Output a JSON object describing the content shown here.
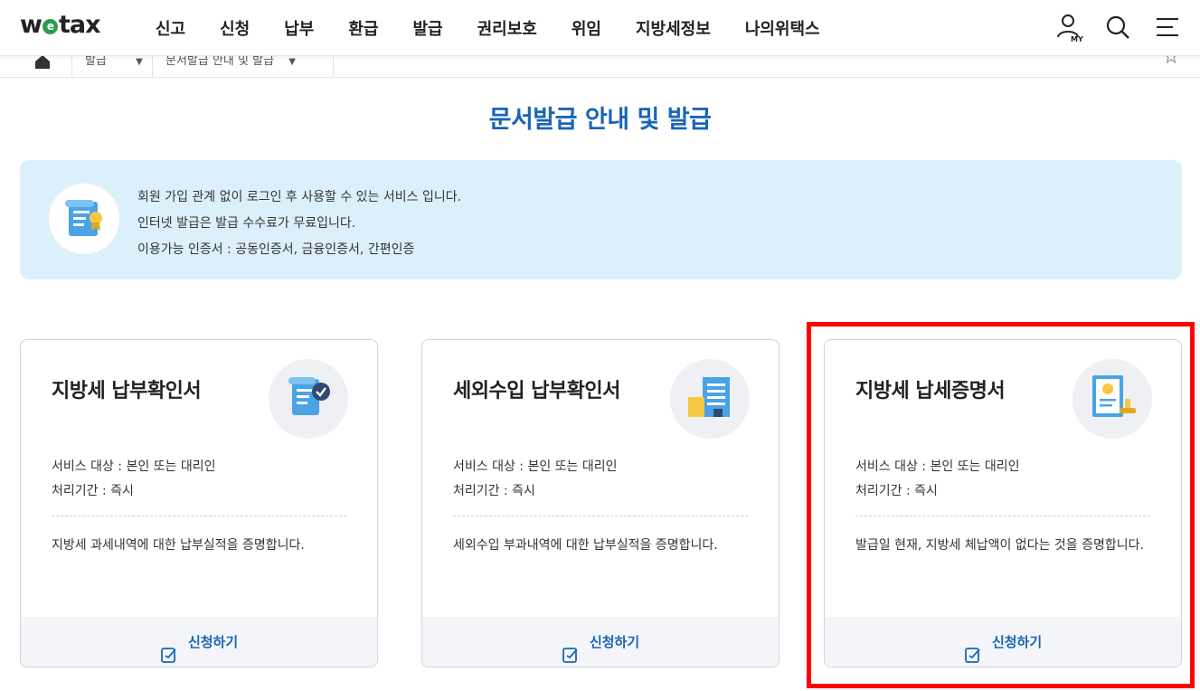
{
  "header": {
    "logo_pre": "w",
    "logo_e": "e",
    "logo_post": "tax",
    "nav": [
      "신고",
      "신청",
      "납부",
      "환급",
      "발급",
      "권리보호",
      "위임",
      "지방세정보",
      "나의위택스"
    ],
    "my_label": "MY"
  },
  "breadcrumb": {
    "items": [
      "발급",
      "문서발급 안내 및 발급"
    ]
  },
  "page_title": "문서발급 안내 및 발급",
  "info": {
    "lines": [
      "회원 가입 관계 없이 로그인 후 사용할 수 있는 서비스 입니다.",
      "인터넷 발급은 발급 수수료가 무료입니다.",
      "이용가능 인증서 : 공동인증서, 금융인증서, 간편인증"
    ]
  },
  "cards": [
    {
      "title": "지방세 납부확인서",
      "target": "서비스 대상 : 본인 또는 대리인",
      "period": "처리기간 : 즉시",
      "desc": "지방세 과세내역에 대한 납부실적을 증명합니다.",
      "apply": "신청하기",
      "icon": "document-check-icon"
    },
    {
      "title": "세외수입 납부확인서",
      "target": "서비스 대상 : 본인 또는 대리인",
      "period": "처리기간 : 즉시",
      "desc": "세외수입 부과내역에 대한 납부실적을 증명합니다.",
      "apply": "신청하기",
      "icon": "building-icon"
    },
    {
      "title": "지방세 납세증명서",
      "target": "서비스 대상 : 본인 또는 대리인",
      "period": "처리기간 : 즉시",
      "desc": "발급일 현재, 지방세 체납액이 없다는 것을 증명합니다.",
      "apply": "신청하기",
      "icon": "certificate-stamp-icon"
    }
  ],
  "colors": {
    "accent": "#1a64b8",
    "info_bg": "#dcf0fb",
    "highlight": "#ff0000"
  }
}
